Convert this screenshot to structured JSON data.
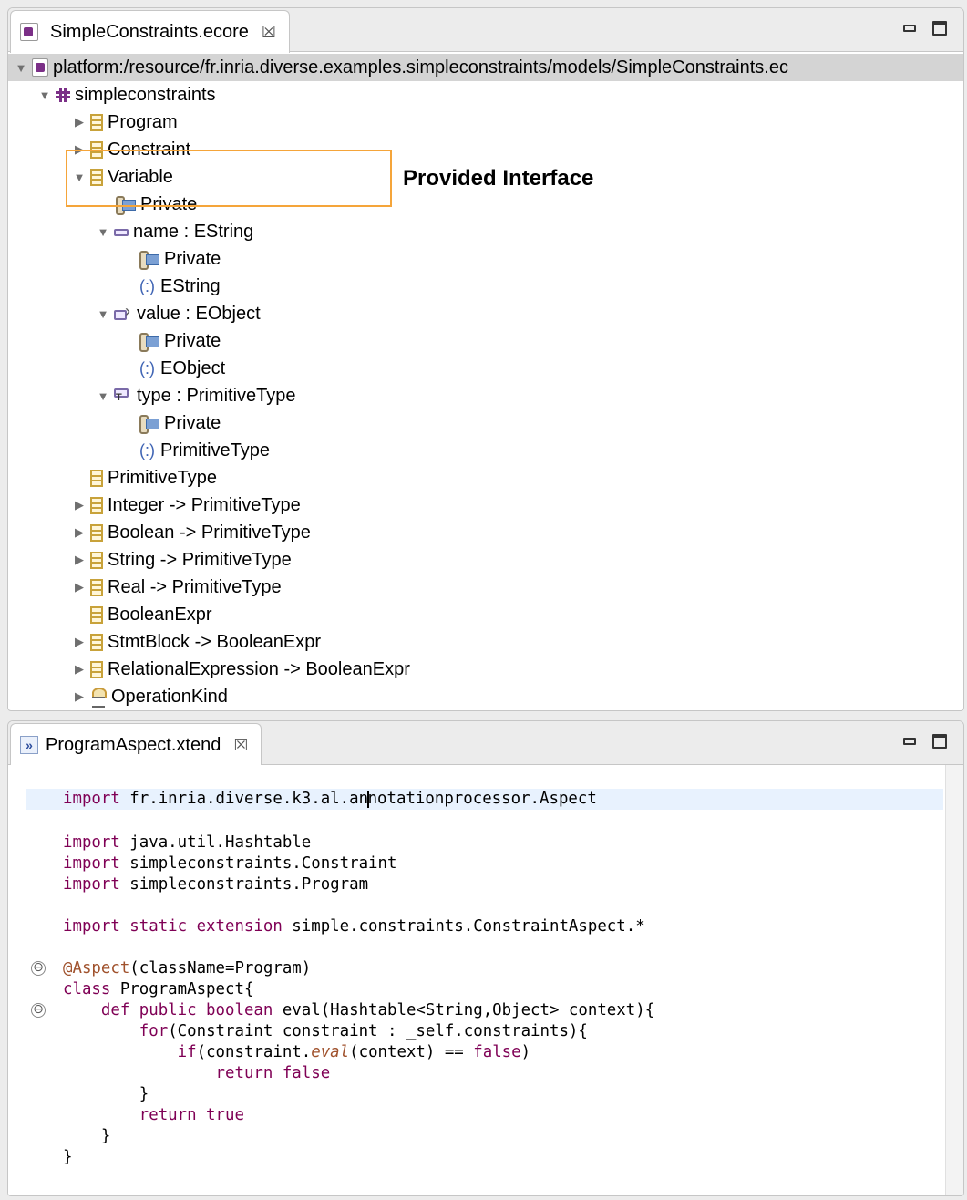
{
  "tree_panel": {
    "tab_title": "SimpleConstraints.ecore",
    "close_glyph": "☒",
    "resource_uri": "platform:/resource/fr.inria.diverse.examples.simpleconstraints/models/SimpleConstraints.ec",
    "package_name": "simpleconstraints",
    "items": {
      "program": "Program",
      "constraint": "Constraint",
      "variable": "Variable",
      "variable_private": "Private",
      "name_attr": "name : EString",
      "name_private": "Private",
      "name_type": "EString",
      "value_ref": "value : EObject",
      "value_private": "Private",
      "value_type": "EObject",
      "type_ref": "type : PrimitiveType",
      "type_private": "Private",
      "type_type": "PrimitiveType",
      "primitivetype": "PrimitiveType",
      "integer": "Integer -> PrimitiveType",
      "boolean": "Boolean -> PrimitiveType",
      "string": "String -> PrimitiveType",
      "real": "Real -> PrimitiveType",
      "booleanexpr": "BooleanExpr",
      "stmtblock": "StmtBlock -> BooleanExpr",
      "relational": "RelationalExpression -> BooleanExpr",
      "operationkind": "OperationKind"
    },
    "generic_marker": "(:)",
    "callout": "Provided Interface"
  },
  "editor_panel": {
    "tab_title": "ProgramAspect.xtend",
    "close_glyph": "☒",
    "code": {
      "l1_kw": "import",
      "l1_a": " fr.inria.diverse.k3.al.an",
      "l1_b": "notationprocessor.Aspect",
      "l3_kw": "import",
      "l3_rest": " java.util.Hashtable",
      "l4_kw": "import",
      "l4_rest": " simpleconstraints.Constraint",
      "l5_kw": "import",
      "l5_rest": " simpleconstraints.Program",
      "l7_kw": "import static extension",
      "l7_rest": " simple.constraints.ConstraintAspect.*",
      "l9_ann": "@Aspect",
      "l9_rest": "(className=Program)",
      "l10_kw": "class",
      "l10_rest": " ProgramAspect{",
      "l11_indent": "    ",
      "l11_kw": "def public boolean",
      "l11_rest": " eval(Hashtable<String,Object> context){",
      "l12_indent": "        ",
      "l12_kw": "for",
      "l12_rest": "(Constraint constraint : _self.constraints){",
      "l13_indent": "            ",
      "l13_kw": "if",
      "l13_a": "(constraint.",
      "l13_it": "eval",
      "l13_b": "(context) == ",
      "l13_kw2": "false",
      "l13_c": ")",
      "l14_indent": "                ",
      "l14_kw": "return false",
      "l15": "        }",
      "l16_indent": "        ",
      "l16_kw": "return true",
      "l17": "    }",
      "l18": "}"
    },
    "fold_glyph": "⊖"
  }
}
